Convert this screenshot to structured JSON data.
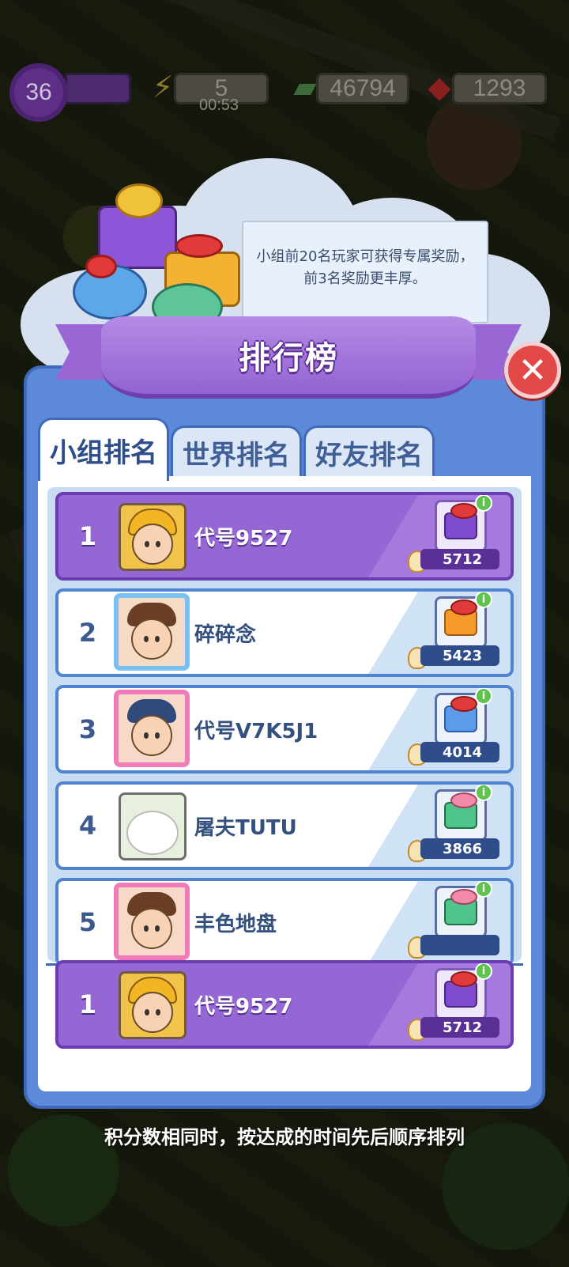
{
  "hud": {
    "level": "36",
    "energy": "5",
    "energy_timer": "00:53",
    "cash": "46794",
    "gems": "1293"
  },
  "dialog": {
    "tip": "小组前20名玩家可获得专属奖励，前3名奖励更丰厚。",
    "title": "排行榜",
    "tabs": [
      "小组排名",
      "世界排名",
      "好友排名"
    ],
    "active_tab": "小组排名",
    "rows": [
      {
        "rank": "1",
        "name": "代号9527",
        "score": "5712",
        "reward_box": "purple",
        "is_self": true
      },
      {
        "rank": "2",
        "name": "碎碎念",
        "score": "5423",
        "reward_box": "orange",
        "is_self": false
      },
      {
        "rank": "3",
        "name": "代号V7K5J1",
        "score": "4014",
        "reward_box": "blue",
        "is_self": false
      },
      {
        "rank": "4",
        "name": "屠夫TUTU",
        "score": "3866",
        "reward_box": "green",
        "is_self": false
      },
      {
        "rank": "5",
        "name": "丰色地盘",
        "score": "",
        "reward_box": "green",
        "is_self": false
      }
    ],
    "self_row": {
      "rank": "1",
      "name": "代号9527",
      "score": "5712",
      "reward_box": "purple"
    },
    "footer_note": "积分数相同时，按达成的时间先后顺序排列"
  },
  "colors": {
    "panel": "#5d8ad8",
    "highlight_row": "#9567d4",
    "banner": "#9363d2",
    "close": "#e34848"
  }
}
